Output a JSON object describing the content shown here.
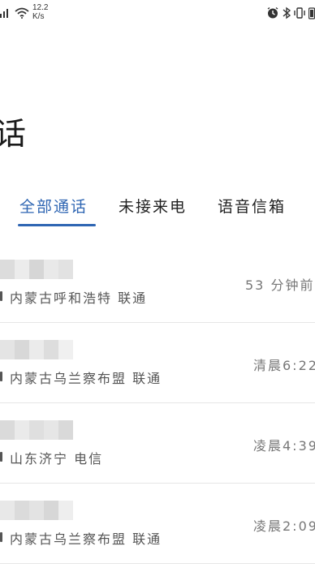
{
  "status_bar": {
    "net_speed_value": "12.2",
    "net_speed_unit": "K/s"
  },
  "header": {
    "title_fragment": "话"
  },
  "tabs": [
    {
      "label": "全部通话",
      "active": true
    },
    {
      "label": "未接来电",
      "active": false
    },
    {
      "label": "语音信箱",
      "active": false
    }
  ],
  "calls": [
    {
      "location": "内蒙古呼和浩特 联通",
      "time": "53 分钟前"
    },
    {
      "location": "内蒙古乌兰察布盟 联通",
      "time": "清晨6:22"
    },
    {
      "location": "山东济宁 电信",
      "time": "凌晨4:39"
    },
    {
      "location": "内蒙古乌兰察布盟 联通",
      "time": "凌晨2:09"
    }
  ],
  "colors": {
    "accent": "#2f66b3",
    "background": "#ffffff",
    "divider": "#e6e6e6"
  }
}
